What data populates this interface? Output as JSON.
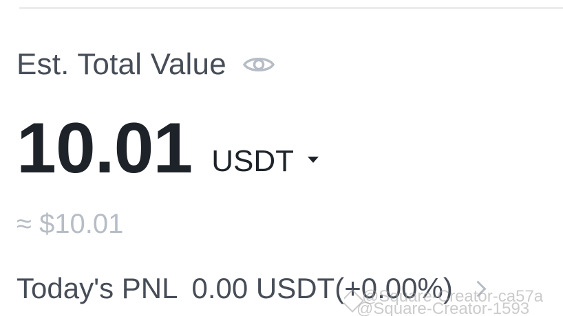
{
  "wallet": {
    "title": "Est. Total Value",
    "visibility_icon": "eye-icon",
    "total_value": "10.01",
    "currency": "USDT",
    "currency_icon": "caret-down-icon",
    "fiat_equivalent": "≈ $10.01",
    "pnl_label": "Today's PNL",
    "pnl_value": "0.00 USDT(+0.00%)",
    "pnl_icon": "chevron-right-icon"
  },
  "watermark": {
    "line1": "@Square-Creator-ca57a",
    "line2": "@Square-Creator-1593"
  },
  "colors": {
    "primary_text": "#1e2329",
    "secondary_text": "#474d57",
    "muted_text": "#b7bdc6",
    "divider": "#eaecef"
  }
}
